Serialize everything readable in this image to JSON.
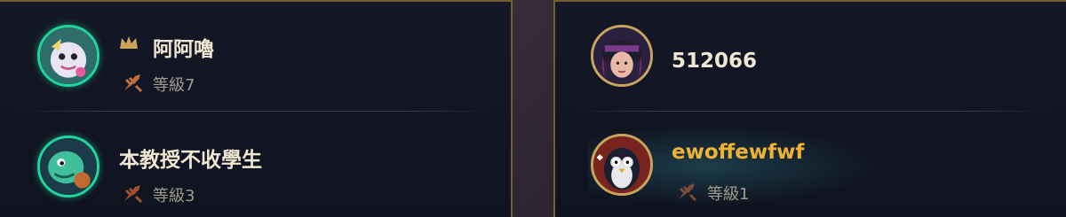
{
  "left_panel": {
    "players": [
      {
        "name": "阿阿嚕",
        "level_label": "等級7",
        "avatar_icon": "poro-champion-icon",
        "has_crown": true
      },
      {
        "name": "本教授不收學生",
        "level_label": "等級3",
        "avatar_icon": "fish-champion-icon",
        "has_crown": false
      }
    ]
  },
  "right_panel": {
    "players": [
      {
        "name": "512066",
        "avatar_icon": "champion-portrait-icon"
      },
      {
        "name": "ewoffewfwf",
        "level_label": "等級1",
        "avatar_icon": "penguin-icon"
      }
    ]
  },
  "colors": {
    "accent_gold": "#f0b232",
    "border_gold": "#7a5d2e",
    "avatar_ring_green": "#1fd69c",
    "level_icon": "#c0703a"
  }
}
